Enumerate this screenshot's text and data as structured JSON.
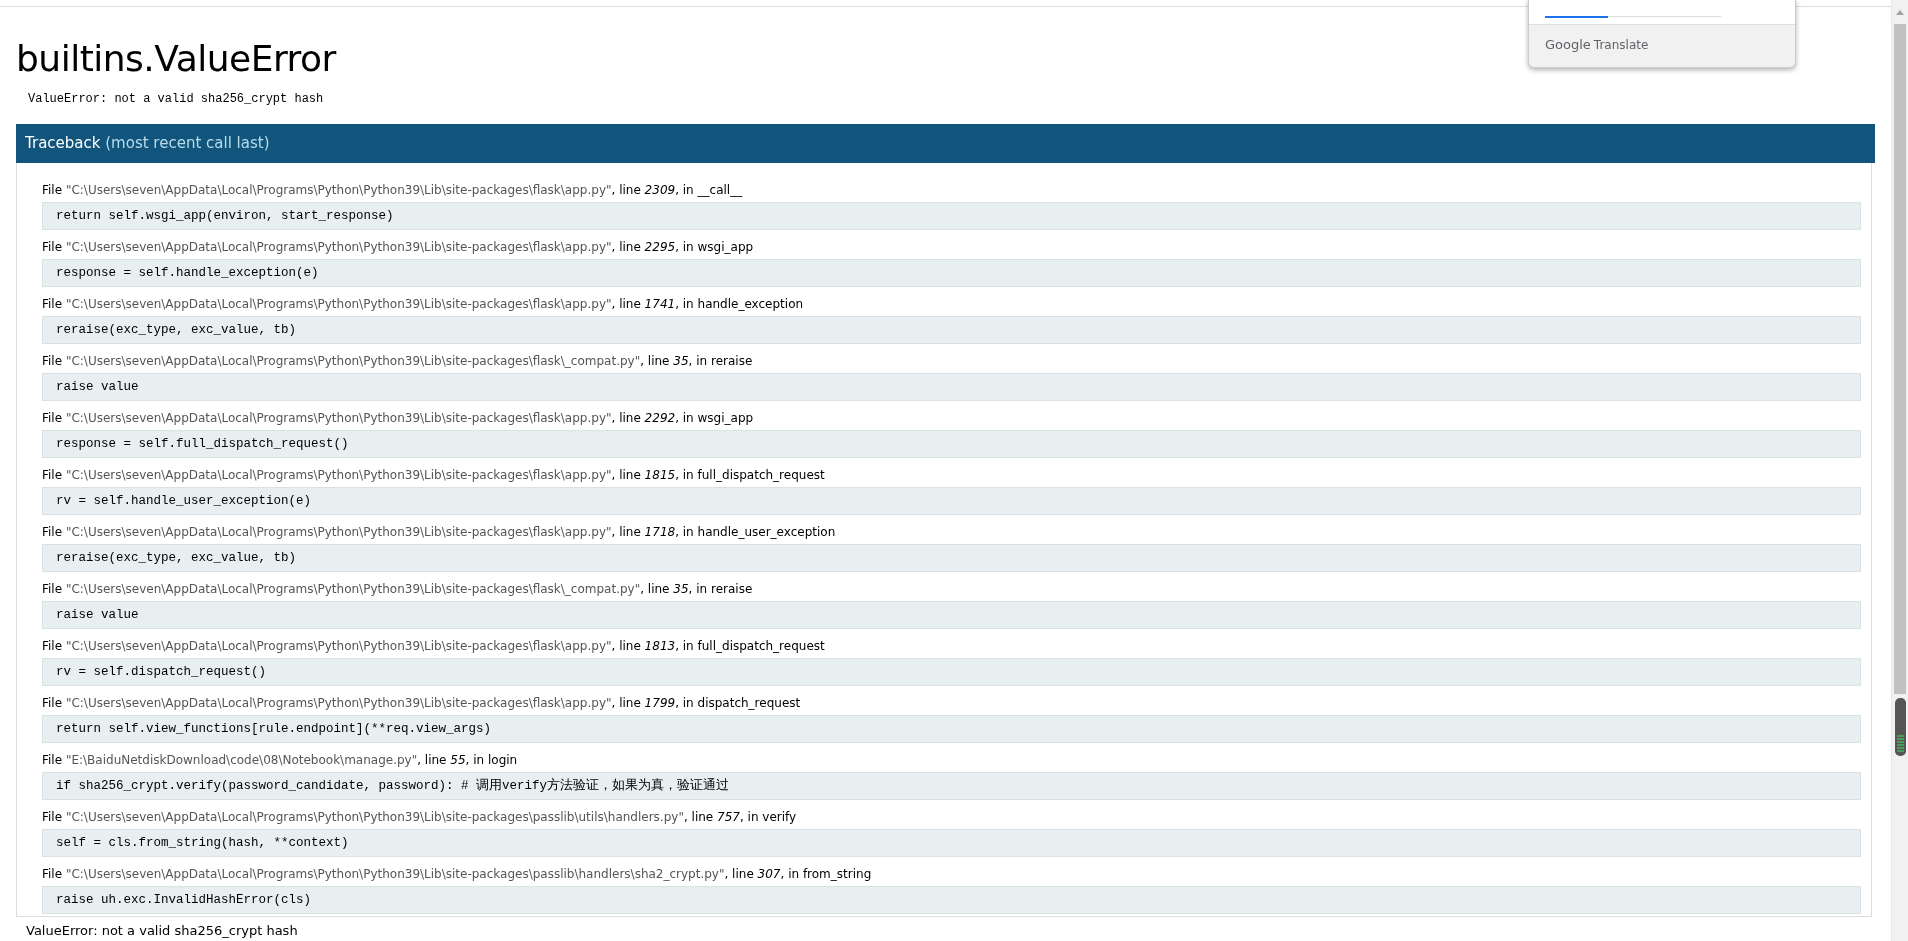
{
  "title": "builtins.ValueError",
  "message": "ValueError: not a valid sha256_crypt hash",
  "traceback": {
    "title": "Traceback",
    "note": "(most recent call last)"
  },
  "frames": [
    {
      "file_label": "File",
      "file": "\"C:\\Users\\seven\\AppData\\Local\\Programs\\Python\\Python39\\Lib\\site-packages\\flask\\app.py\"",
      "line_label": ", line",
      "line": "2309",
      "in_label": ", in",
      "function": "__call__",
      "code": "return self.wsgi_app(environ, start_response)"
    },
    {
      "file_label": "File",
      "file": "\"C:\\Users\\seven\\AppData\\Local\\Programs\\Python\\Python39\\Lib\\site-packages\\flask\\app.py\"",
      "line_label": ", line",
      "line": "2295",
      "in_label": ", in",
      "function": "wsgi_app",
      "code": "response = self.handle_exception(e)"
    },
    {
      "file_label": "File",
      "file": "\"C:\\Users\\seven\\AppData\\Local\\Programs\\Python\\Python39\\Lib\\site-packages\\flask\\app.py\"",
      "line_label": ", line",
      "line": "1741",
      "in_label": ", in",
      "function": "handle_exception",
      "code": "reraise(exc_type, exc_value, tb)"
    },
    {
      "file_label": "File",
      "file": "\"C:\\Users\\seven\\AppData\\Local\\Programs\\Python\\Python39\\Lib\\site-packages\\flask\\_compat.py\"",
      "line_label": ", line",
      "line": "35",
      "in_label": ", in",
      "function": "reraise",
      "code": "raise value"
    },
    {
      "file_label": "File",
      "file": "\"C:\\Users\\seven\\AppData\\Local\\Programs\\Python\\Python39\\Lib\\site-packages\\flask\\app.py\"",
      "line_label": ", line",
      "line": "2292",
      "in_label": ", in",
      "function": "wsgi_app",
      "code": "response = self.full_dispatch_request()"
    },
    {
      "file_label": "File",
      "file": "\"C:\\Users\\seven\\AppData\\Local\\Programs\\Python\\Python39\\Lib\\site-packages\\flask\\app.py\"",
      "line_label": ", line",
      "line": "1815",
      "in_label": ", in",
      "function": "full_dispatch_request",
      "code": "rv = self.handle_user_exception(e)"
    },
    {
      "file_label": "File",
      "file": "\"C:\\Users\\seven\\AppData\\Local\\Programs\\Python\\Python39\\Lib\\site-packages\\flask\\app.py\"",
      "line_label": ", line",
      "line": "1718",
      "in_label": ", in",
      "function": "handle_user_exception",
      "code": "reraise(exc_type, exc_value, tb)"
    },
    {
      "file_label": "File",
      "file": "\"C:\\Users\\seven\\AppData\\Local\\Programs\\Python\\Python39\\Lib\\site-packages\\flask\\_compat.py\"",
      "line_label": ", line",
      "line": "35",
      "in_label": ", in",
      "function": "reraise",
      "code": "raise value"
    },
    {
      "file_label": "File",
      "file": "\"C:\\Users\\seven\\AppData\\Local\\Programs\\Python\\Python39\\Lib\\site-packages\\flask\\app.py\"",
      "line_label": ", line",
      "line": "1813",
      "in_label": ", in",
      "function": "full_dispatch_request",
      "code": "rv = self.dispatch_request()"
    },
    {
      "file_label": "File",
      "file": "\"C:\\Users\\seven\\AppData\\Local\\Programs\\Python\\Python39\\Lib\\site-packages\\flask\\app.py\"",
      "line_label": ", line",
      "line": "1799",
      "in_label": ", in",
      "function": "dispatch_request",
      "code": "return self.view_functions[rule.endpoint](**req.view_args)"
    },
    {
      "file_label": "File",
      "file": "\"E:\\BaiduNetdiskDownload\\code\\08\\Notebook\\manage.py\"",
      "line_label": ", line",
      "line": "55",
      "in_label": ", in",
      "function": "login",
      "code": "if sha256_crypt.verify(password_candidate, password): # 调用verify方法验证，如果为真，验证通过"
    },
    {
      "file_label": "File",
      "file": "\"C:\\Users\\seven\\AppData\\Local\\Programs\\Python\\Python39\\Lib\\site-packages\\passlib\\utils\\handlers.py\"",
      "line_label": ", line",
      "line": "757",
      "in_label": ", in",
      "function": "verify",
      "code": "self = cls.from_string(hash, **context)"
    },
    {
      "file_label": "File",
      "file": "\"C:\\Users\\seven\\AppData\\Local\\Programs\\Python\\Python39\\Lib\\site-packages\\passlib\\handlers\\sha2_crypt.py\"",
      "line_label": ", line",
      "line": "307",
      "in_label": ", in",
      "function": "from_string",
      "code": "raise uh.exc.InvalidHashError(cls)"
    }
  ],
  "final_message": "ValueError: not a valid sha256_crypt hash",
  "translate_popup": {
    "level": 0.36,
    "logo": "Google",
    "label": "Translate"
  }
}
